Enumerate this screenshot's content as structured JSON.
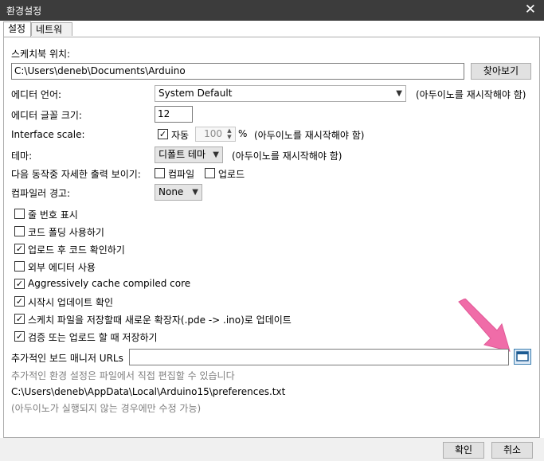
{
  "window": {
    "title": "환경설정"
  },
  "tabs": [
    {
      "label": "설정"
    },
    {
      "label": "네트워크"
    }
  ],
  "sketchbook": {
    "label": "스케치북 위치:",
    "value": "C:\\Users\\deneb\\Documents\\Arduino",
    "browse_label": "찾아보기"
  },
  "editor_language": {
    "label": "에디터 언어:",
    "value": "System Default",
    "note": "(아두이노를 재시작해야 함)"
  },
  "font_size": {
    "label": "에디터 글꼴 크기:",
    "value": "12"
  },
  "interface_scale": {
    "label": "Interface scale:",
    "auto_label": "자동",
    "value": "100",
    "unit": "%",
    "note": "(아두이노를 재시작해야 함)"
  },
  "theme": {
    "label": "테마:",
    "value": "디폴트 테마",
    "note": "(아두이노를 재시작해야 함)"
  },
  "verbose": {
    "label": "다음 동작중 자세한  출력 보이기:",
    "compile_label": "컴파일",
    "upload_label": "업로드"
  },
  "compiler_warnings": {
    "label": "컴파일러 경고:",
    "value": "None"
  },
  "options": [
    {
      "label": "줄 번호 표시",
      "checked": false
    },
    {
      "label": "코드 폴딩 사용하기",
      "checked": false
    },
    {
      "label": "업로드 후 코드 확인하기",
      "checked": true
    },
    {
      "label": "외부 에디터 사용",
      "checked": false
    },
    {
      "label": "Aggressively cache compiled core",
      "checked": true
    },
    {
      "label": "시작시 업데이트 확인",
      "checked": true
    },
    {
      "label": "스케치 파일을 저장할때 새로운 확장자(.pde -> .ino)로 업데이트",
      "checked": true
    },
    {
      "label": "검증 또는 업로드 할 때 저장하기",
      "checked": true
    }
  ],
  "board_urls": {
    "label": "추가적인 보드 매니저 URLs",
    "value": ""
  },
  "prefs_note": "추가적인 환경 설정은 파일에서 직접 편집할 수 있습니다",
  "prefs_path": "C:\\Users\\deneb\\AppData\\Local\\Arduino15\\preferences.txt",
  "prefs_hint": "(아두이노가 실행되지 않는 경우에만 수정 가능)",
  "buttons": {
    "ok": "확인",
    "cancel": "취소"
  },
  "colors": {
    "titlebar": "#3c3c3c",
    "accent_arrow": "#f06ca8",
    "panel_border": "#adadad"
  }
}
